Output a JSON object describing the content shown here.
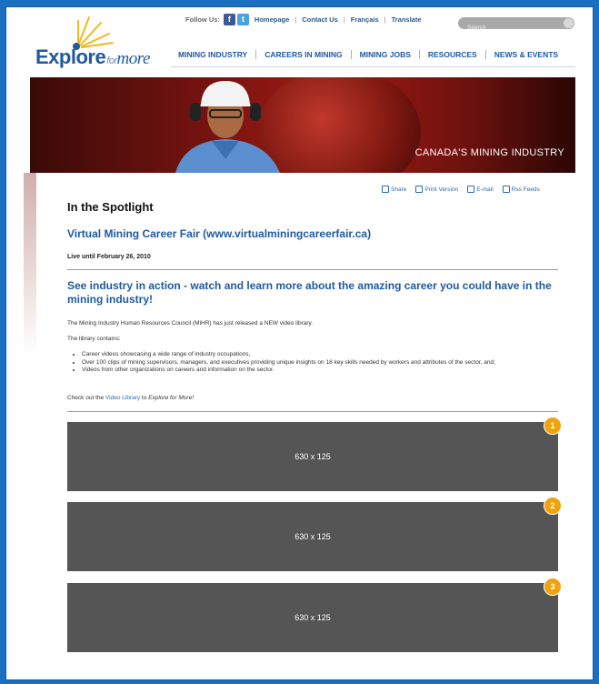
{
  "header": {
    "follow_label": "Follow Us:",
    "links": [
      "Homepage",
      "Contact Us",
      "Français",
      "Translate"
    ],
    "search_placeholder": "Search",
    "logo_main": "Explore",
    "logo_for": "for",
    "logo_more": "more"
  },
  "nav": {
    "items": [
      "MINING INDUSTRY",
      "CAREERS IN MINING",
      "MINING JOBS",
      "RESOURCES",
      "NEWS & EVENTS"
    ]
  },
  "banner": {
    "caption": "CANADA'S MINING INDUSTRY"
  },
  "tools": {
    "share": "Share",
    "print": "Print Version",
    "email": "E-mail",
    "rss": "Rss Feeds"
  },
  "content": {
    "section_title": "In the Spotlight",
    "fair_title": "Virtual Mining Career Fair (www.virtualminingcareerfair.ca)",
    "live_until": "Live until February 26, 2010",
    "headline": "See industry in action - watch and learn more about the amazing career you could have in the mining industry!",
    "intro": "The Mining Industry Human Resources Council (MiHR) has just released a NEW video library.",
    "library_contains": "The library contains:",
    "bullets": [
      "Career videos showcasing a wide range of industry occupations,",
      "Over 100 clips of mining supervisors, managers, and executives providing unique insights on 18 key skills needed by workers and attributes of the sector, and;",
      "Videos from other organizations on careers and information on the sector."
    ],
    "check_prefix": "Check out the ",
    "video_library_link": "Video Library",
    "check_middle": " to ",
    "check_italic": "Explore for More!"
  },
  "placeholders": [
    {
      "label": "630 x 125",
      "badge": "1"
    },
    {
      "label": "630 x 125",
      "badge": "2"
    },
    {
      "label": "630 x 125",
      "badge": "3"
    }
  ],
  "colors": {
    "background": "#1a6fc0",
    "brand_blue": "#1f5aa0",
    "badge": "#f0a30a",
    "placeholder": "#555555"
  }
}
